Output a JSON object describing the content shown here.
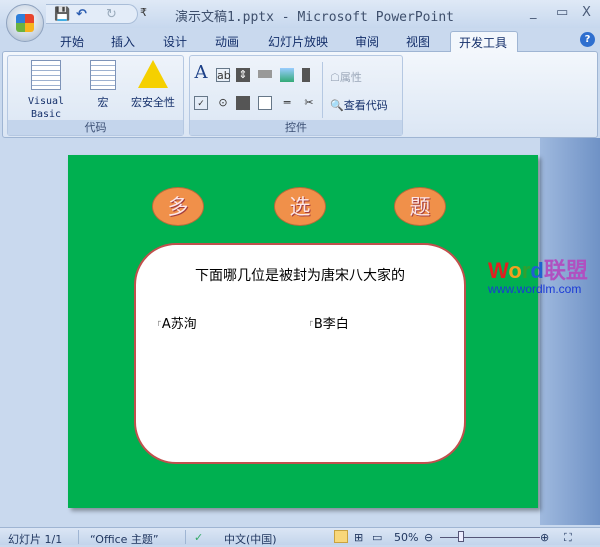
{
  "window": {
    "title": "演示文稿1.pptx - Microsoft PowerPoint",
    "minimize": "_",
    "maximize": "▭",
    "close": "X"
  },
  "qat": {
    "save": "💾",
    "undo": "↶",
    "redo": "↻",
    "customize": "₹"
  },
  "tabs": [
    "开始",
    "插入",
    "设计",
    "动画",
    "幻灯片放映",
    "审阅",
    "视图",
    "开发工具"
  ],
  "active_tab": "开发工具",
  "help": "?",
  "ribbon": {
    "code_group": {
      "label": "代码",
      "buttons": [
        "Visual Basic",
        "宏",
        "宏安全性"
      ]
    },
    "controls_group": {
      "label": "控件",
      "properties": "属性",
      "view_code": "查看代码"
    }
  },
  "slide": {
    "ovals": [
      "多",
      "选",
      "题"
    ],
    "question": "下面哪几位是被封为唐宋八大家的",
    "options": [
      "A苏洵",
      "B李白"
    ]
  },
  "watermark": {
    "brand_w": "W",
    "brand_o": "o",
    "brand_r": "r",
    "brand_d": "d",
    "brand_cn": "联盟",
    "url": "www.wordlm.com"
  },
  "status": {
    "slide": "幻灯片 1/1",
    "theme": "“Office 主题”",
    "language": "中文(中国)",
    "zoom": "50%"
  }
}
